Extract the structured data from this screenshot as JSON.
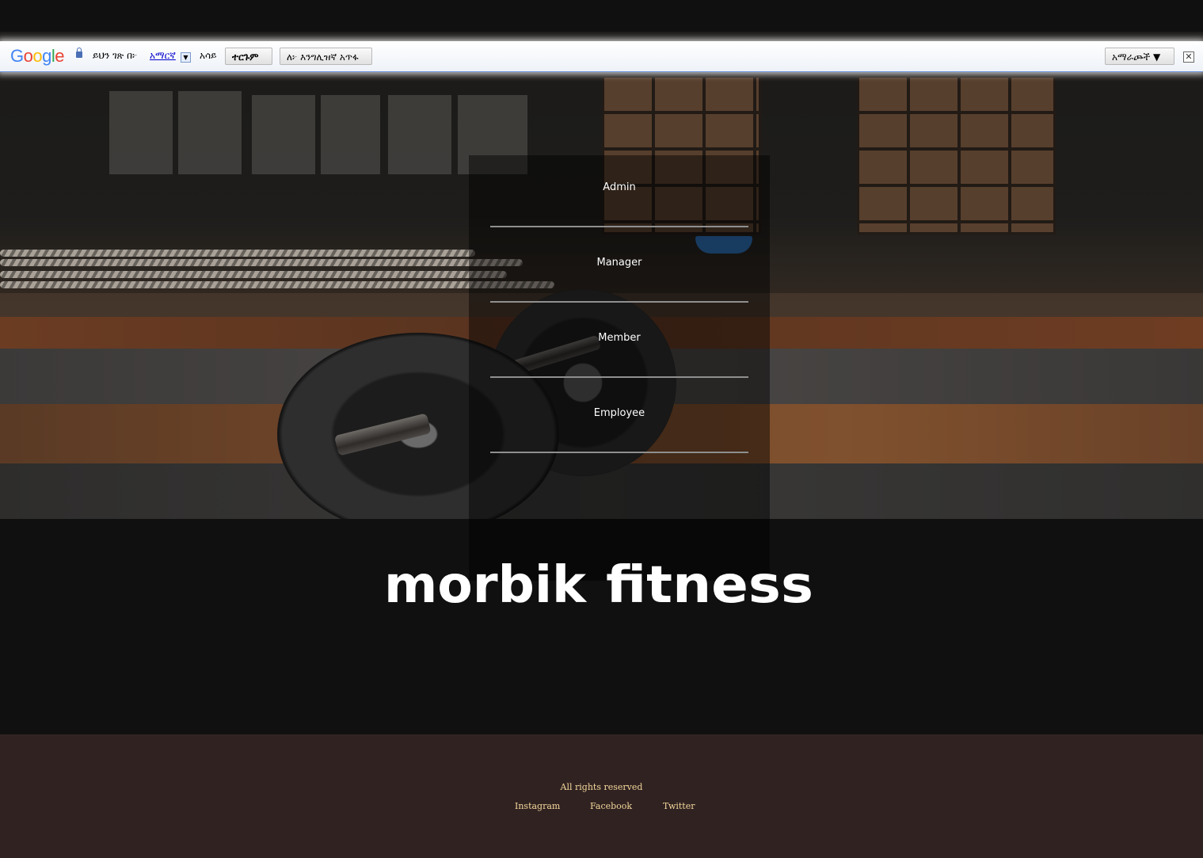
{
  "translate_bar": {
    "logo_letters": [
      {
        "ch": "G",
        "color": "#4285F4"
      },
      {
        "ch": "o",
        "color": "#EA4335"
      },
      {
        "ch": "o",
        "color": "#FBBC05"
      },
      {
        "ch": "g",
        "color": "#4285F4"
      },
      {
        "ch": "l",
        "color": "#34A853"
      },
      {
        "ch": "e",
        "color": "#EA4335"
      }
    ],
    "page_in_label": "ይህን ገጽ በ፦",
    "language_link": "አማርኛ",
    "dropdown_glyph": "▼",
    "show_label": "አሳይ",
    "translate_button": "ተርጉም",
    "turn_off_button": "ለ፦ እንግሊዝኛ አጥፋ",
    "options_button": "አማራጮች ▼",
    "close_glyph": "✕"
  },
  "login_roles": [
    "Admin",
    "Manager",
    "Member",
    "Employee"
  ],
  "brand": {
    "name_part1": "morbik",
    "name_part2": "fitness"
  },
  "footer": {
    "rights": "All rights reserved",
    "links": [
      "Instagram",
      "Facebook",
      "Twitter"
    ]
  },
  "colors": {
    "page_bg": "#111010",
    "footer_bg": "#312222",
    "footer_text": "#f2d79a",
    "role_text": "#ffffff"
  }
}
